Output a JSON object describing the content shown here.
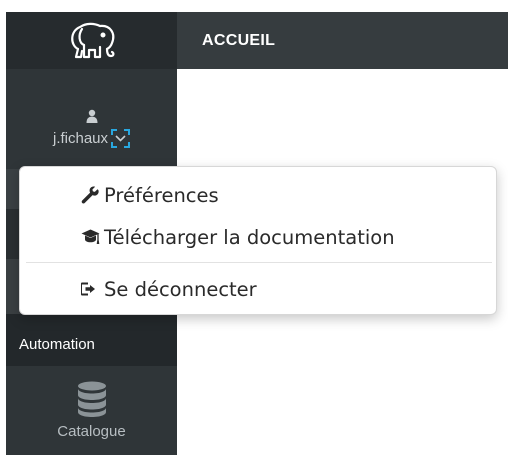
{
  "header": {
    "title": "ACCUEIL"
  },
  "sidebar": {
    "logo": "elephant-logo",
    "user": {
      "name": "j.fichaux",
      "icon": "user-icon",
      "toggle_icon": "chevron-down-icon"
    },
    "items": [
      {
        "label": "Automation",
        "icon": ""
      },
      {
        "label": "Catalogue",
        "icon": "database-icon"
      }
    ]
  },
  "user_menu": {
    "items": [
      {
        "label": "Préférences",
        "icon": "wrench-icon"
      },
      {
        "label": "Télécharger la documentation",
        "icon": "graduation-cap-icon"
      }
    ],
    "logout": {
      "label": "Se déconnecter",
      "icon": "sign-out-icon"
    }
  },
  "colors": {
    "sidebar": "#2f3538",
    "header": "#363c3f",
    "focus_outline": "#29a8e0"
  }
}
